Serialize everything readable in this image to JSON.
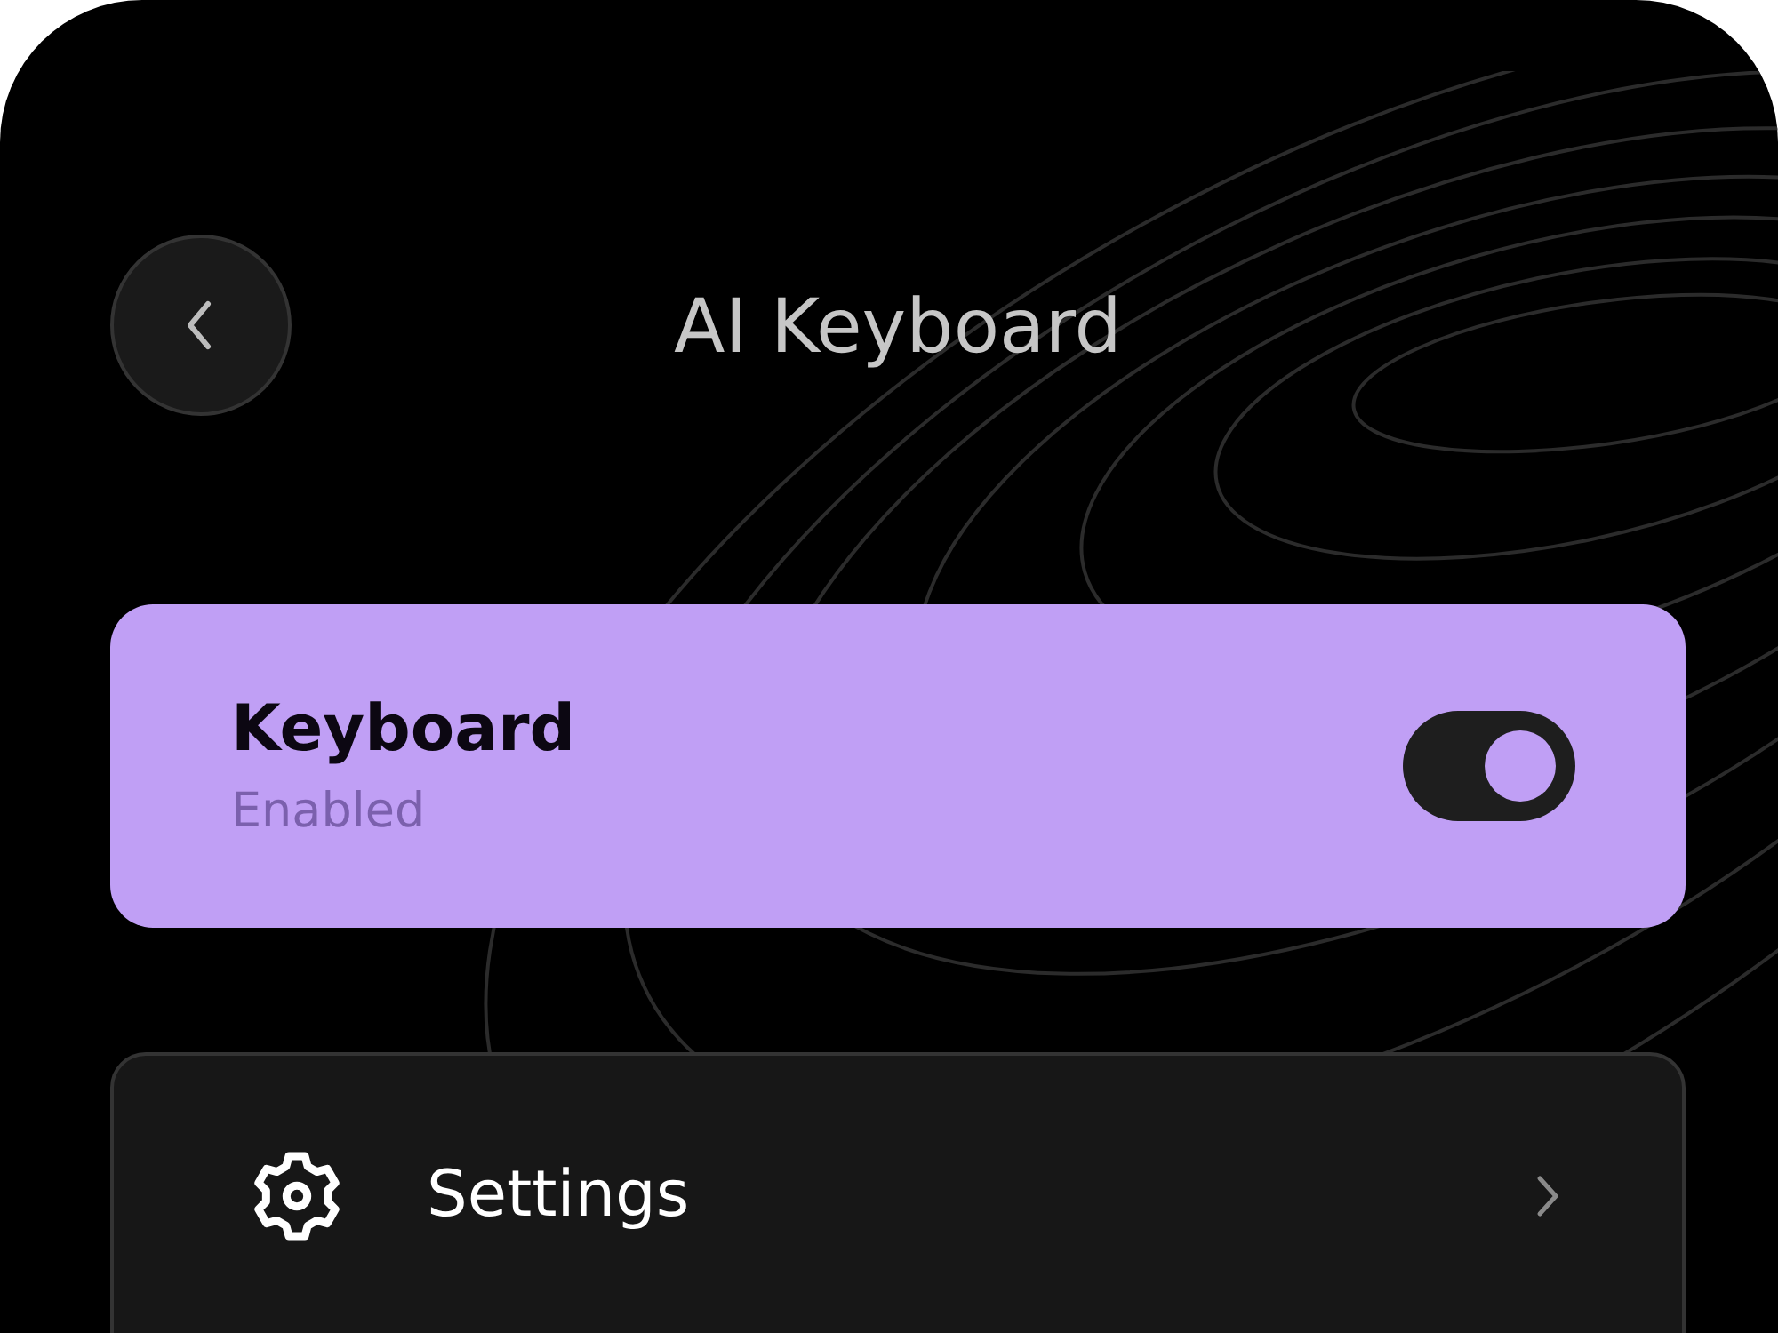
{
  "header": {
    "title": "AI Keyboard"
  },
  "keyboard_card": {
    "title": "Keyboard",
    "status": "Enabled",
    "on": true
  },
  "menu": [
    {
      "label": "Settings",
      "kind": "settings"
    }
  ]
}
